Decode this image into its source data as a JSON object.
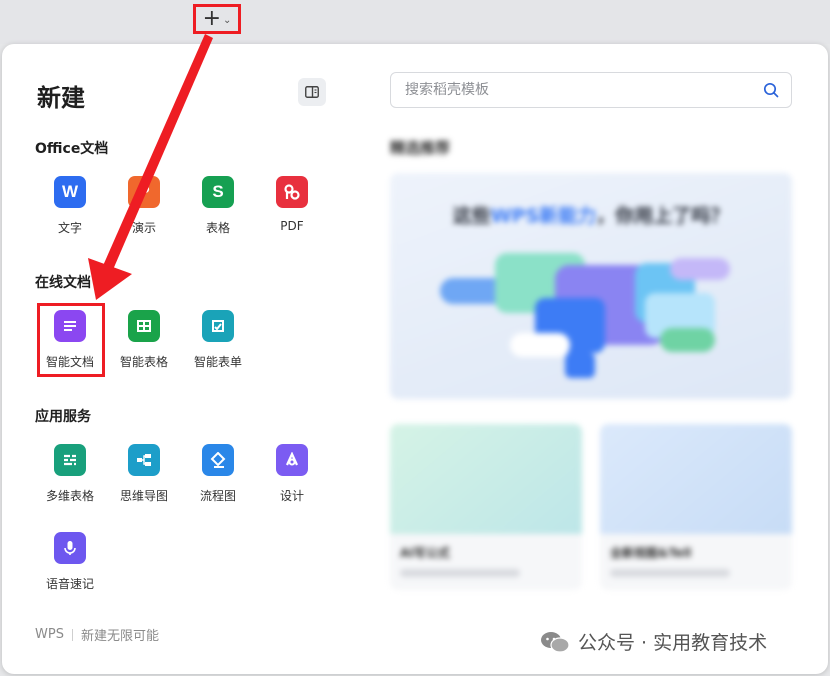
{
  "toolbar": {
    "new_chevron": "⌄"
  },
  "panel": {
    "title": "新建",
    "search_placeholder": "搜索稻壳模板"
  },
  "sections": {
    "office": {
      "title": "Office文档",
      "items": [
        {
          "label": "文字",
          "glyph": "W",
          "color": "#2d6cf0"
        },
        {
          "label": "演示",
          "glyph": "P",
          "color": "#f0682d"
        },
        {
          "label": "表格",
          "glyph": "S",
          "color": "#16a052"
        },
        {
          "label": "PDF",
          "glyph": "P",
          "color": "#e8303e"
        }
      ]
    },
    "online": {
      "title": "在线文档",
      "items": [
        {
          "label": "智能文档",
          "color": "#8b47f1"
        },
        {
          "label": "智能表格",
          "color": "#1aa34a"
        },
        {
          "label": "智能表单",
          "color": "#1aa3b8"
        }
      ]
    },
    "services": {
      "title": "应用服务",
      "items": [
        {
          "label": "多维表格",
          "color": "#18a07c"
        },
        {
          "label": "思维导图",
          "color": "#1d9ec9"
        },
        {
          "label": "流程图",
          "color": "#2a87e8"
        },
        {
          "label": "设计",
          "color": "#7b5cf2"
        },
        {
          "label": "语音速记",
          "color": "#6d57ef"
        }
      ]
    }
  },
  "footer": {
    "brand": "WPS",
    "tagline": "新建无限可能"
  },
  "recommend": {
    "title": "精选推荐",
    "banner_headline_prefix": "这些",
    "banner_headline_accent": "WPS新能力",
    "banner_headline_suffix": "，你用上了吗？",
    "card1_title": "AI写公式",
    "card2_title": "全新视图&Tell"
  },
  "watermark": {
    "text": "公众号 · 实用教育技术"
  },
  "colors": {
    "highlight": "#ee1d23",
    "arrow": "#ee1d23"
  }
}
